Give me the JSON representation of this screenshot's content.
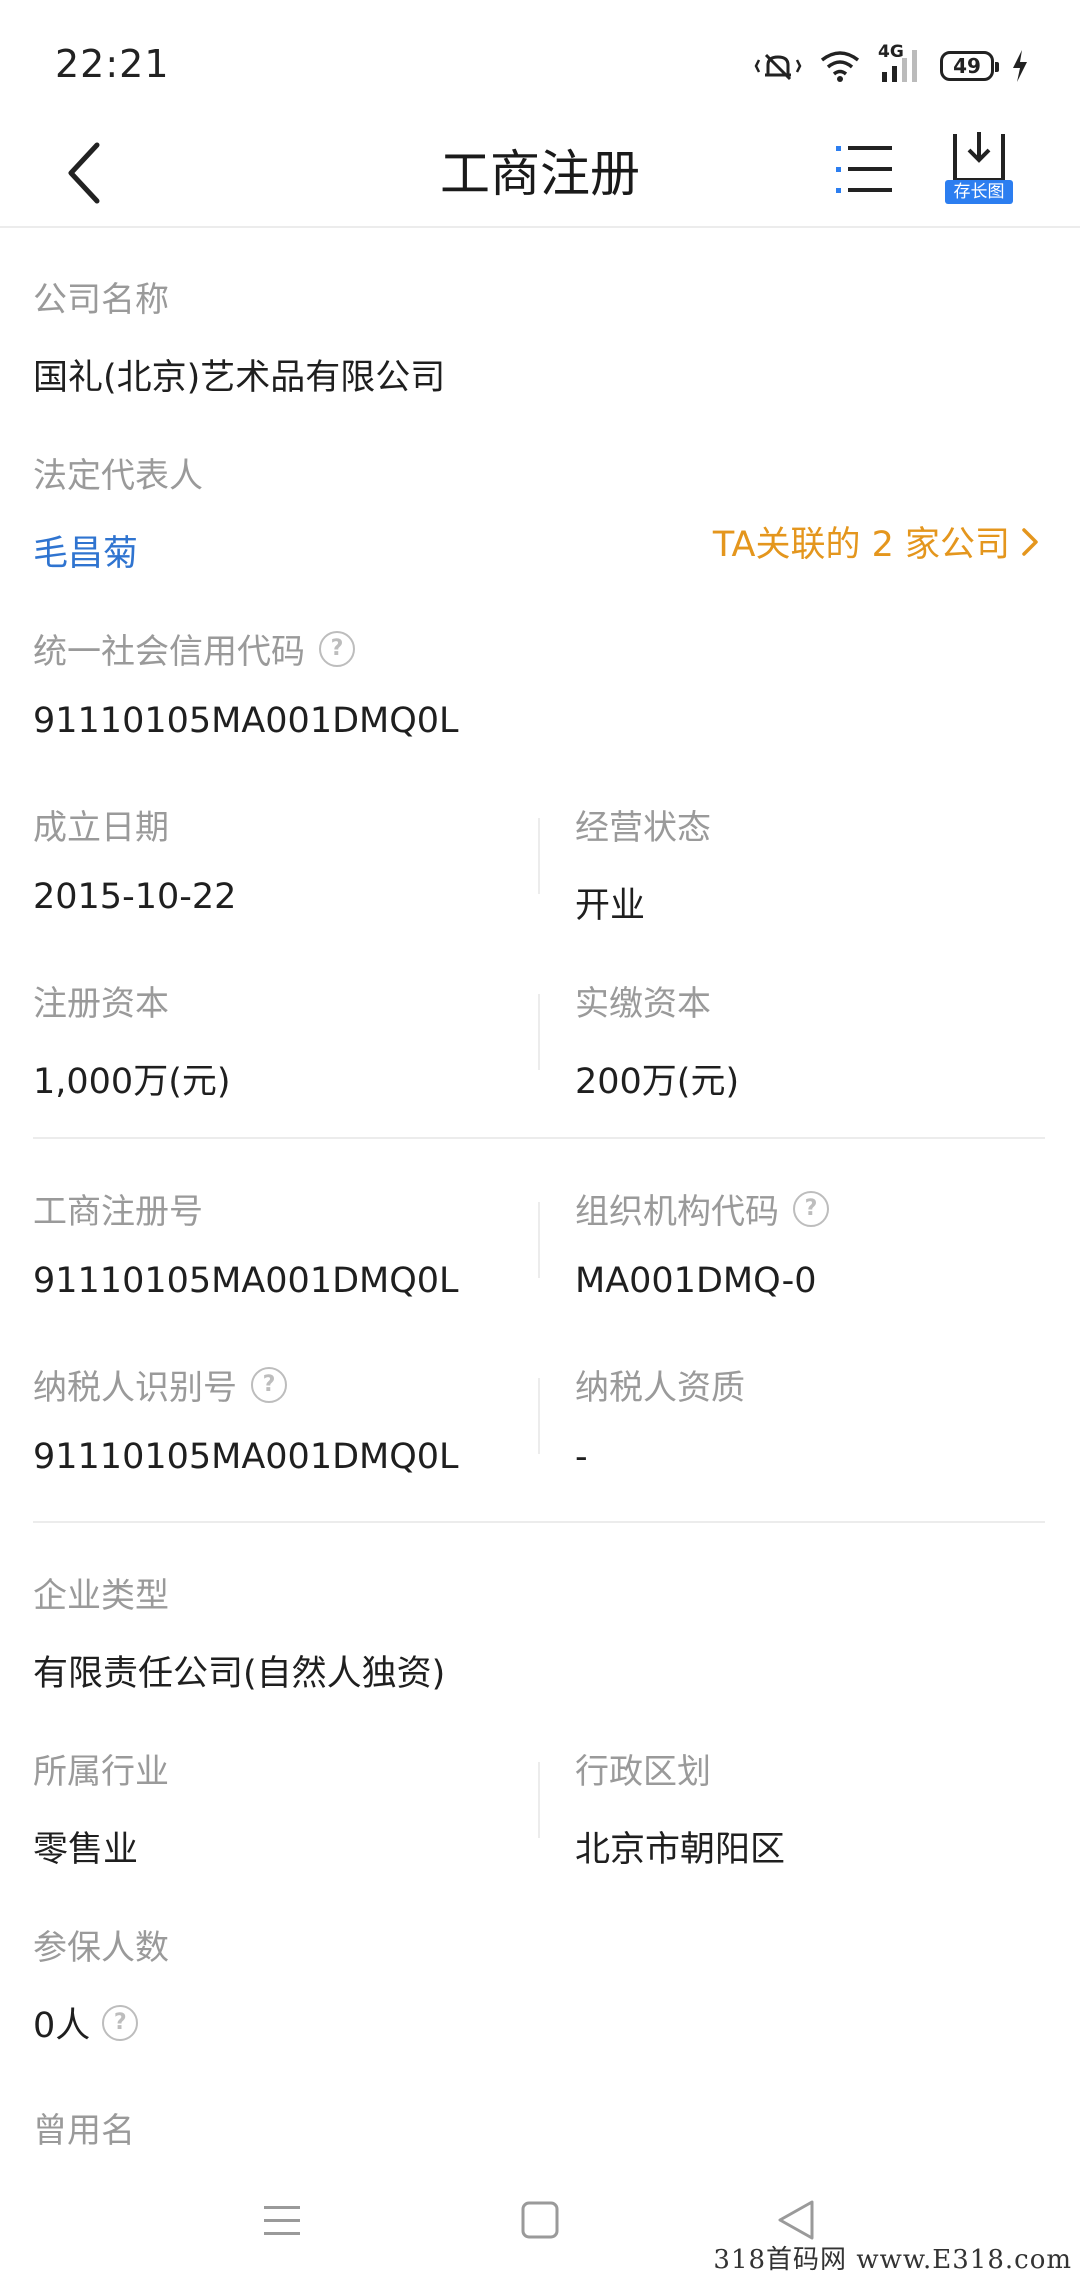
{
  "status_bar": {
    "time": "22:21",
    "network": "4G",
    "battery": "49"
  },
  "header": {
    "title": "工商注册",
    "save_label": "存长图"
  },
  "fields": {
    "company_name": {
      "label": "公司名称",
      "value": "国礼(北京)艺术品有限公司"
    },
    "legal_rep": {
      "label": "法定代表人",
      "value": "毛昌菊",
      "related": "TA关联的 2 家公司"
    },
    "credit_code": {
      "label": "统一社会信用代码",
      "value": "91110105MA001DMQ0L"
    },
    "founded": {
      "label": "成立日期",
      "value": "2015-10-22"
    },
    "status": {
      "label": "经营状态",
      "value": "开业"
    },
    "reg_capital": {
      "label": "注册资本",
      "value": "1,000万(元)"
    },
    "paid_capital": {
      "label": "实缴资本",
      "value": "200万(元)"
    },
    "reg_no": {
      "label": "工商注册号",
      "value": "91110105MA001DMQ0L"
    },
    "org_code": {
      "label": "组织机构代码",
      "value": "MA001DMQ-0"
    },
    "taxpayer_id": {
      "label": "纳税人识别号",
      "value": "91110105MA001DMQ0L"
    },
    "taxpayer_qual": {
      "label": "纳税人资质",
      "value": "-"
    },
    "company_type": {
      "label": "企业类型",
      "value": "有限责任公司(自然人独资)"
    },
    "industry": {
      "label": "所属行业",
      "value": "零售业"
    },
    "region": {
      "label": "行政区划",
      "value": "北京市朝阳区"
    },
    "insured": {
      "label": "参保人数",
      "value": "0人"
    },
    "former_name": {
      "label": "曾用名"
    }
  },
  "watermark": "318首码网 www.E318.com",
  "colors": {
    "link_blue": "#2f74d0",
    "related_orange": "#e4961d",
    "badge_blue": "#2c7ef0",
    "label_gray": "#9a9a9a"
  },
  "icons": [
    "back-arrow-icon",
    "list-menu-icon",
    "download-icon",
    "question-icon",
    "chevron-right-icon",
    "nav-menu-icon",
    "nav-home-icon",
    "nav-back-icon"
  ]
}
